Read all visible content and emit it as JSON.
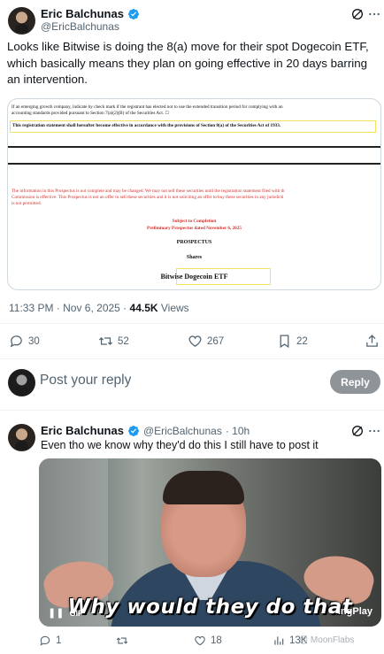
{
  "post": {
    "author_name": "Eric Balchunas",
    "author_handle": "@EricBalchunas",
    "text": "Looks like Bitwise is doing the 8(a) move for their spot Dogecoin ETF, which basically means they plan on going effective in 20 days barring an intervention.",
    "timestamp": "11:33 PM · Nov 6, 2025 · ",
    "views_count": "44.5K",
    "views_label": " Views",
    "actions": {
      "replies": "30",
      "reposts": "52",
      "likes": "267",
      "bookmarks": "22"
    },
    "document": {
      "line1": "If an emerging growth company, indicate by check mark if the registrant has elected not to use the extended transition period for complying with an",
      "line2": "accounting standards provided pursuant to Section 7(a)(2)(B) of the Securities Act. ☐",
      "highlight": "This registration statement shall hereafter become effective in accordance with the provisions of Section 8(a) of the Securities Act of 1933.",
      "red1": "The information in this Prospectus is not complete and may be changed. We may not sell these securities until the registration statement filed with th",
      "red2": "Commission is effective. This Prospectus is not an offer to sell these securities and it is not soliciting an offer to buy these securities in any jurisdicti",
      "red3": "is not permitted.",
      "subject": "Subject to Completion",
      "preliminary": "Preliminary Prospectus dated November 6, 2025",
      "prospectus": "PROSPECTUS",
      "shares": "Shares",
      "fund_name": "Bitwise Dogecoin ETF"
    }
  },
  "reply_composer": {
    "placeholder": "Post your reply",
    "button_label": "Reply"
  },
  "reply": {
    "author_name": "Eric Balchunas",
    "author_handle": "@EricBalchunas",
    "time": "· 10h",
    "text": "Even tho we know why they'd do this I still have to post it",
    "media": {
      "caption": "Why would they do that",
      "gif_badge": "GIF",
      "brand": "ingPlay"
    },
    "actions": {
      "replies": "1",
      "reposts": "",
      "likes": "18",
      "views": "13K"
    }
  },
  "watermark": "@ MoonFlabs",
  "colors": {
    "accent_blue": "#1d9bf0",
    "secondary_text": "#536471",
    "doc_red": "#d3322e",
    "highlight_yellow": "#f4e25e",
    "reply_button": "#8f9499"
  }
}
